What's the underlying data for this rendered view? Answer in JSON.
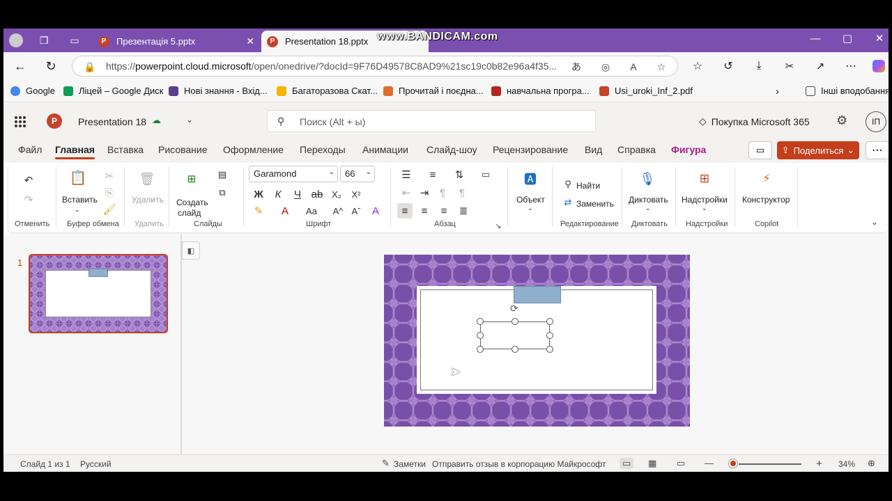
{
  "browser": {
    "tabs": [
      {
        "title": "Презентація 5.pptx",
        "close": "✕"
      },
      {
        "title": "Presentation 18.pptx",
        "close": "✕"
      }
    ],
    "watermark": "www.BANDICAM.com",
    "url_prefix": "https://",
    "url_host": "powerpoint.cloud.microsoft",
    "url_path": "/open/onedrive/?docId=9F76D49578C8AD9%21sc19c0b82e96a4f35...",
    "bookmarks": [
      {
        "label": "Google",
        "color": "#4285f4"
      },
      {
        "label": "Ліцей – Google Диск",
        "color": "#0f9d58"
      },
      {
        "label": "Нові знання - Вхід...",
        "color": "#5a3e8c"
      },
      {
        "label": "Багаторазова Скат...",
        "color": "#f4b400"
      },
      {
        "label": "Прочитай і поєдна...",
        "color": "#e06c2c"
      },
      {
        "label": "навчальна програ...",
        "color": "#b3261e"
      },
      {
        "label": "Usi_uroki_Inf_2.pdf",
        "color": "#c4432b"
      }
    ],
    "other_bookmarks": "Інші вподобання"
  },
  "app": {
    "doc_title": "Presentation 18",
    "search_placeholder": "Поиск (Alt + ы)",
    "buy_label": "Покупка Microsoft 365",
    "avatar": "ІП",
    "share_label": "Поделиться"
  },
  "menu": [
    "Файл",
    "Главная",
    "Вставка",
    "Рисование",
    "Оформление",
    "Переходы",
    "Анимации",
    "Слайд-шоу",
    "Рецензирование",
    "Вид",
    "Справка",
    "Фигура"
  ],
  "ribbon": {
    "paste": "Вставить",
    "delete": "Удалить",
    "new_slide_1": "Создать",
    "new_slide_2": "слайд",
    "font": "Garamond",
    "size": "66",
    "object": "Объект",
    "find": "Найти",
    "replace": "Заменить",
    "dictate": "Диктовать",
    "addins": "Надстройки",
    "designer": "Конструктор",
    "groups": {
      "undo": "Отменить",
      "clipboard": "Буфер обмена",
      "delete": "Удалить",
      "slides": "Слайды",
      "font": "Шрифт",
      "paragraph": "Абзац",
      "editing": "Редактирование",
      "dictate": "Диктовать",
      "addins": "Надстройки",
      "copilot": "Copilot"
    }
  },
  "thumbs": {
    "number": "1"
  },
  "status": {
    "slide_info": "Слайд 1 из 1",
    "language": "Русский",
    "notes": "Заметки",
    "feedback": "Отправить отзыв в корпорацию Майкрософт",
    "zoom": "34%"
  },
  "colors": {
    "accent": "#c43e1c",
    "tabbar": "#7b4fb0",
    "slide_bg": "#7a4fa8",
    "shape": "#8fb0cc"
  }
}
